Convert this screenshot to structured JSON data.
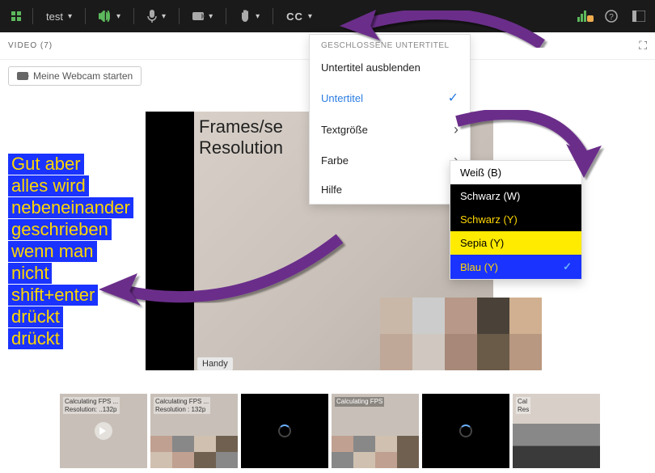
{
  "toolbar": {
    "session_name": "test",
    "cc_label": "CC"
  },
  "panel": {
    "title": "VIDEO (7)",
    "webcam_button": "Meine Webcam starten"
  },
  "main_video": {
    "overlay_line1": "Frames/se",
    "overlay_line2": "Resolution",
    "label": "Handy"
  },
  "captions": [
    "Gut aber",
    "alles wird",
    "nebeneinander",
    "geschrieben",
    "wenn man",
    "nicht",
    "shift+enter",
    "drückt",
    "drückt"
  ],
  "cc_menu": {
    "header": "GESCHLOSSENE UNTERTITEL",
    "hide": "Untertitel ausblenden",
    "subtitles": "Untertitel",
    "textsize": "Textgröße",
    "color": "Farbe",
    "help": "Hilfe"
  },
  "color_menu": {
    "white": "Weiß (B)",
    "black_w": "Schwarz (W)",
    "black_y": "Schwarz (Y)",
    "sepia": "Sepia (Y)",
    "blue": "Blau (Y)"
  },
  "thumbs": [
    {
      "line1": "Calculating FPS ...",
      "line2": "Resolution: ..132p"
    },
    {
      "line1": "Calculating FPS ...",
      "line2": "Resolution : 132p"
    },
    {
      "line1": "",
      "line2": ""
    },
    {
      "line1": "Calculating FPS",
      "line2": ""
    },
    {
      "line1": "",
      "line2": ""
    },
    {
      "line1": "Cal",
      "line2": "Res"
    }
  ]
}
